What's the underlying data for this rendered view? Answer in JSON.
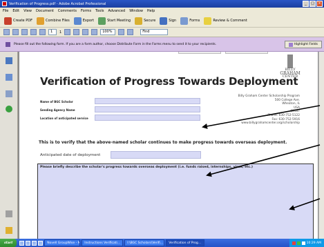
{
  "window": {
    "title": "Verification of Progress.pdf - Adobe Acrobat Professional"
  },
  "menu": [
    "File",
    "Edit",
    "View",
    "Document",
    "Comments",
    "Forms",
    "Tools",
    "Advanced",
    "Window",
    "Help"
  ],
  "toolbar": {
    "create_pdf": "Create PDF",
    "combine_files": "Combine Files",
    "export": "Export",
    "start_meeting": "Start Meeting",
    "secure": "Secure",
    "sign": "Sign",
    "forms": "Forms",
    "review_comment": "Review & Comment"
  },
  "nav": {
    "page_number": "1",
    "page_count": "1",
    "zoom": "100%",
    "find_placeholder": "Find"
  },
  "message_bar": {
    "text": "Please fill out the following form. If you are a form author, choose Distribute Form in the Forms menu to send it to your recipients.",
    "highlight_button": "Highlight Fields"
  },
  "document": {
    "title": "Verification of Progress Towards Deployment",
    "logo": [
      "BILLY",
      "GRAHAM",
      "CENTER"
    ],
    "fields": {
      "scholar_label": "Name of BGC Scholar",
      "agency_label": "Sending Agency Name",
      "location_label": "Location of anticipated service"
    },
    "address": [
      "Billy Graham Center Scholarship Program",
      "500 College Ave.",
      "Wheaton, IL",
      "USA",
      "60187",
      "Phone: 630-752-5122",
      "Fax: 630-752-5916",
      "www.billygrahamcenter.org/scholarship"
    ],
    "statement": "This is to verify that the above-named scholar continues to make progress towards overseas deployment.",
    "date_label": "Anticipated date of deployment",
    "description_label": "Please briefly describe the scholar's progress towards overseas deployment (i.e. funds raised, internships, visas, etc.)"
  },
  "taskbar": {
    "start": "start",
    "tasks": [
      "Novell GroupWise - M...",
      "Instructions Verificati...",
      "I:\\BGC Scholars\\Verifi...",
      "Verification of Prog..."
    ],
    "clock": "10:29 AM"
  },
  "colors": {
    "field_fill": "#d8daf6",
    "message_bar": "#d8c4e8",
    "title_bar": "#1b3fa0"
  }
}
